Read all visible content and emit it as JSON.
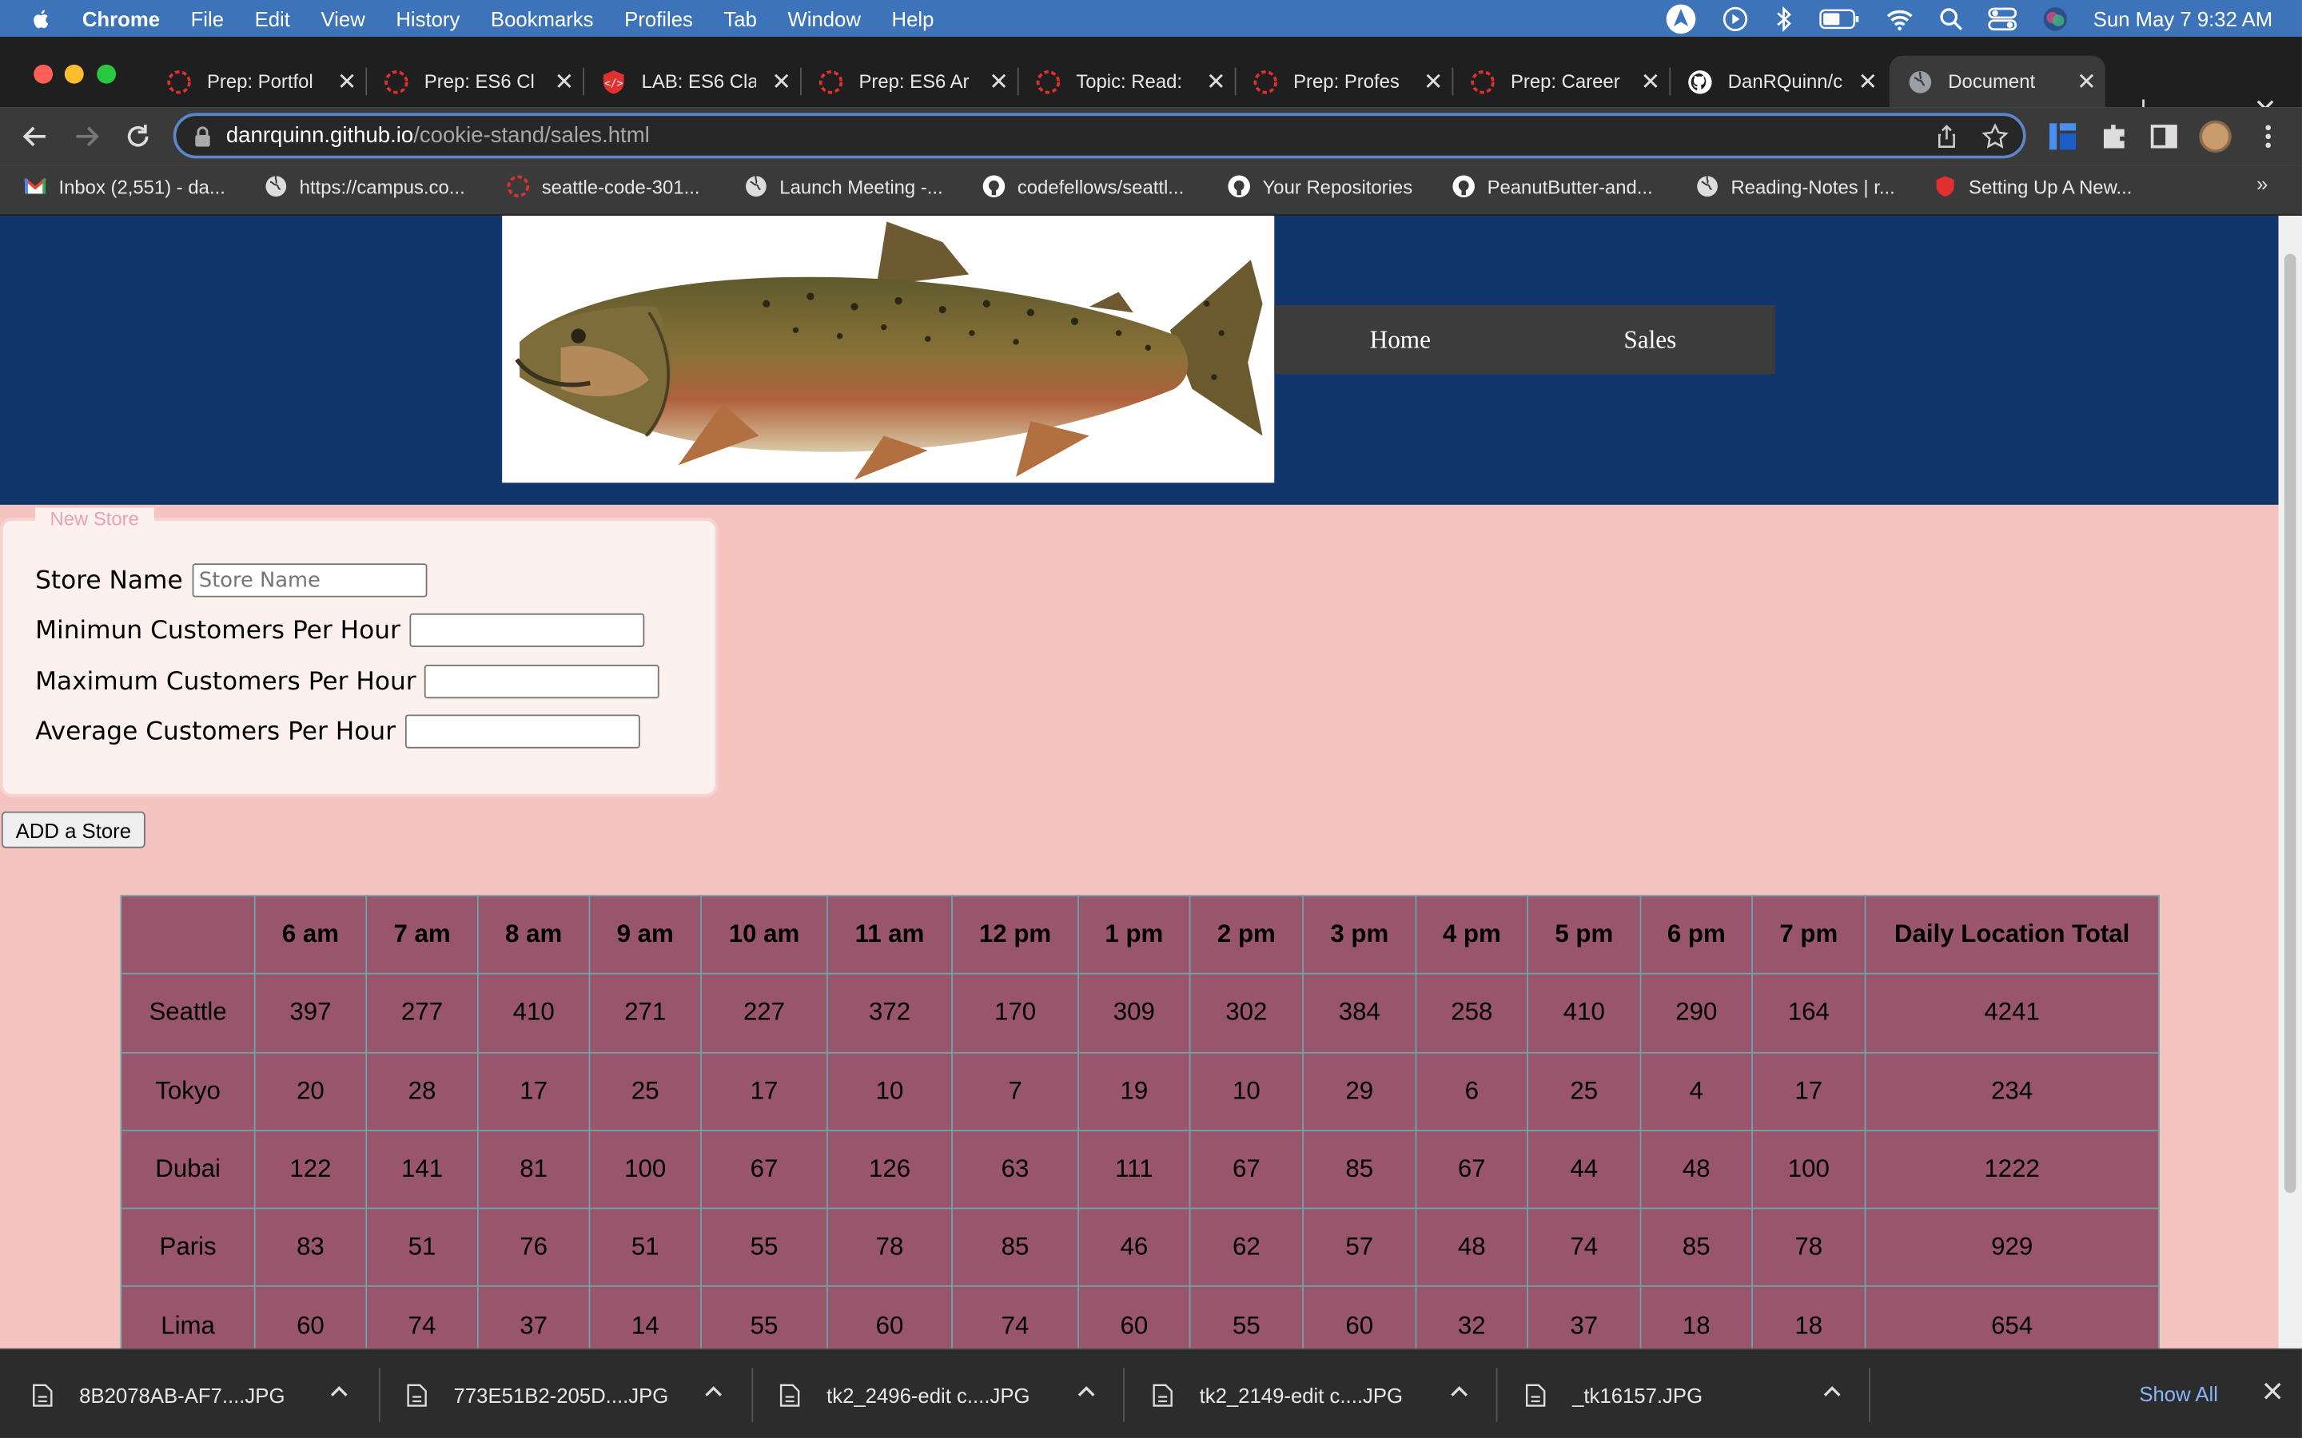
{
  "menubar": {
    "app": "Chrome",
    "items": [
      "File",
      "Edit",
      "View",
      "History",
      "Bookmarks",
      "Profiles",
      "Tab",
      "Window",
      "Help"
    ],
    "clock": "Sun May 7  9:32 AM"
  },
  "tabs": [
    {
      "title": "Prep: Portfol",
      "icon": "codefellows-icon"
    },
    {
      "title": "Prep: ES6 Cl",
      "icon": "codefellows-icon"
    },
    {
      "title": "LAB: ES6 Cla",
      "icon": "shield-code-icon"
    },
    {
      "title": "Prep: ES6 Ar",
      "icon": "codefellows-icon"
    },
    {
      "title": "Topic: Read:",
      "icon": "codefellows-icon"
    },
    {
      "title": "Prep: Profes",
      "icon": "codefellows-icon"
    },
    {
      "title": "Prep: Career",
      "icon": "codefellows-icon"
    },
    {
      "title": "DanRQuinn/c",
      "icon": "github-icon"
    },
    {
      "title": "Document",
      "icon": "globe-icon",
      "active": true
    }
  ],
  "address": {
    "host": "danrquinn.github.io",
    "path": "/cookie-stand/sales.html"
  },
  "bookmarks": [
    {
      "label": "Inbox (2,551) - da...",
      "icon": "gmail-icon"
    },
    {
      "label": "https://campus.co...",
      "icon": "globe-icon"
    },
    {
      "label": "seattle-code-301...",
      "icon": "codefellows-icon"
    },
    {
      "label": "Launch Meeting -...",
      "icon": "globe-icon"
    },
    {
      "label": "codefellows/seattl...",
      "icon": "github-icon"
    },
    {
      "label": "Your Repositories",
      "icon": "github-icon"
    },
    {
      "label": "PeanutButter-and...",
      "icon": "github-icon"
    },
    {
      "label": "Reading-Notes | r...",
      "icon": "globe-icon"
    },
    {
      "label": "Setting Up A New...",
      "icon": "shield-code-icon"
    }
  ],
  "site": {
    "nav": [
      "Home",
      "Sales"
    ]
  },
  "form": {
    "legend": "New Store",
    "store_name_label": "Store Name",
    "store_name_placeholder": "Store Name",
    "min_label": "Minimun Customers Per Hour",
    "max_label": "Maximum Customers Per Hour",
    "avg_label": "Average Customers Per Hour",
    "submit_label": "ADD a Store"
  },
  "table": {
    "headers": [
      "",
      "6 am",
      "7 am",
      "8 am",
      "9 am",
      "10 am",
      "11 am",
      "12 pm",
      "1 pm",
      "2 pm",
      "3 pm",
      "4 pm",
      "5 pm",
      "6 pm",
      "7 pm",
      "Daily Location Total"
    ],
    "rows": [
      [
        "Seattle",
        "397",
        "277",
        "410",
        "271",
        "227",
        "372",
        "170",
        "309",
        "302",
        "384",
        "258",
        "410",
        "290",
        "164",
        "4241"
      ],
      [
        "Tokyo",
        "20",
        "28",
        "17",
        "25",
        "17",
        "10",
        "7",
        "19",
        "10",
        "29",
        "6",
        "25",
        "4",
        "17",
        "234"
      ],
      [
        "Dubai",
        "122",
        "141",
        "81",
        "100",
        "67",
        "126",
        "63",
        "111",
        "67",
        "85",
        "67",
        "44",
        "48",
        "100",
        "1222"
      ],
      [
        "Paris",
        "83",
        "51",
        "76",
        "51",
        "55",
        "78",
        "85",
        "46",
        "62",
        "57",
        "48",
        "74",
        "85",
        "78",
        "929"
      ],
      [
        "Lima",
        "60",
        "74",
        "37",
        "14",
        "55",
        "60",
        "74",
        "60",
        "55",
        "60",
        "32",
        "37",
        "18",
        "18",
        "654"
      ]
    ]
  },
  "downloads": {
    "files": [
      "8B2078AB-AF7....JPG",
      "773E51B2-205D....JPG",
      "tk2_2496-edit c....JPG",
      "tk2_2149-edit c....JPG",
      "_tk16157.JPG"
    ],
    "show_all": "Show All"
  }
}
